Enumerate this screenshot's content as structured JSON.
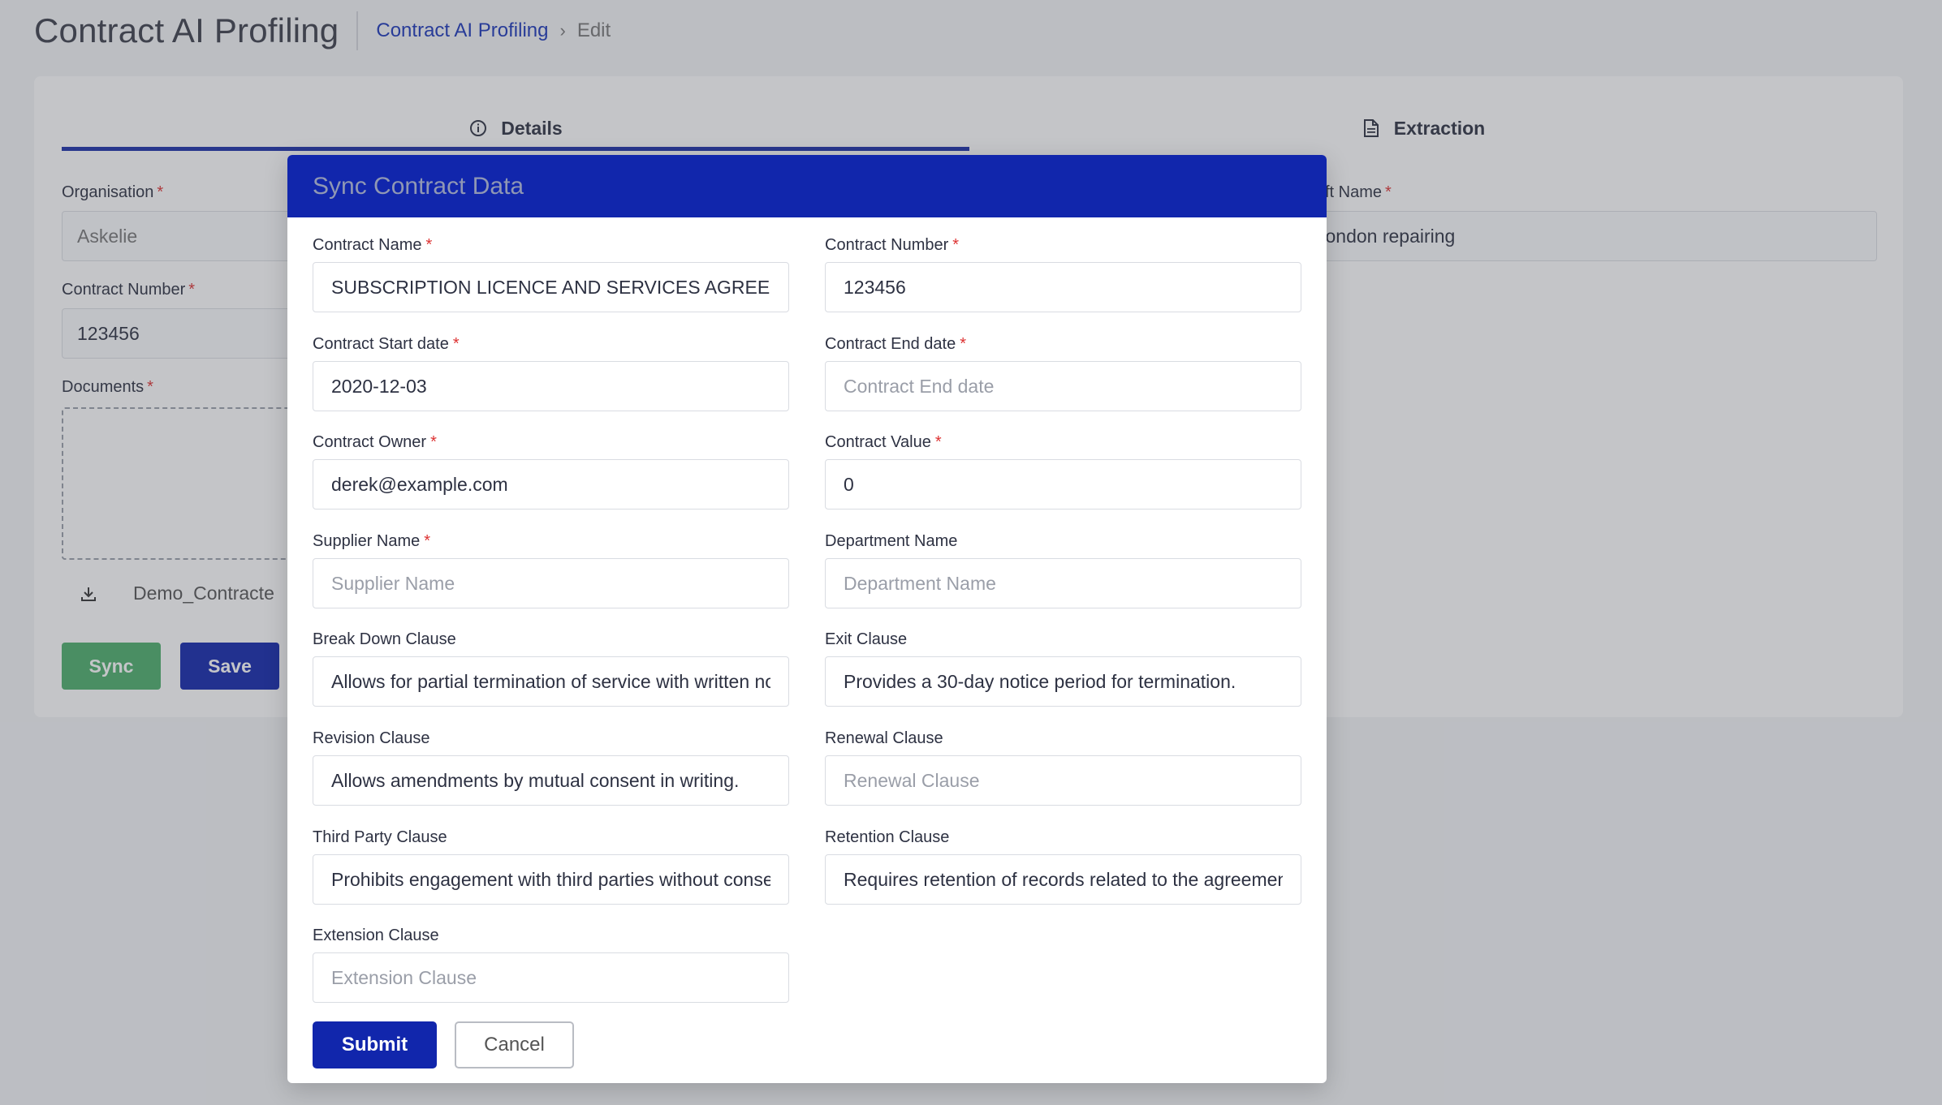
{
  "page": {
    "title": "Contract AI Profiling",
    "breadcrumb": {
      "link": "Contract AI Profiling",
      "separator": "›",
      "current": "Edit"
    }
  },
  "tabs": [
    {
      "label": "Details",
      "icon": "info-icon",
      "active": true
    },
    {
      "label": "Extraction",
      "icon": "document-icon",
      "active": false
    }
  ],
  "background_form": {
    "organisation_label": "Organisation",
    "organisation_value": "Askelie",
    "contract_number_label": "Contract Number",
    "contract_number_value": "123456",
    "documents_label": "Documents",
    "file_name": "Demo_Contracte",
    "right_label_partial": "ft Name",
    "right_value_partial": "vondon repairing",
    "sync_label": "Sync",
    "save_label": "Save"
  },
  "colors": {
    "primary": "#1126ac",
    "sync_green": "#4caf6a",
    "required": "#dd3333",
    "link": "#1a35b8"
  },
  "modal": {
    "title": "Sync Contract Data",
    "fields": {
      "contract_name": {
        "label": "Contract Name",
        "required": true,
        "value": "SUBSCRIPTION LICENCE AND SERVICES AGREEMENT",
        "placeholder": "Contract Name"
      },
      "contract_number": {
        "label": "Contract Number",
        "required": true,
        "value": "123456",
        "placeholder": "Contract Number"
      },
      "contract_start_date": {
        "label": "Contract Start date",
        "required": true,
        "value": "2020-12-03",
        "placeholder": "Contract Start date"
      },
      "contract_end_date": {
        "label": "Contract End date",
        "required": true,
        "value": "",
        "placeholder": "Contract End date"
      },
      "contract_owner": {
        "label": "Contract Owner",
        "required": true,
        "value": "derek@example.com",
        "placeholder": "Contract Owner"
      },
      "contract_value": {
        "label": "Contract Value",
        "required": true,
        "value": "0",
        "placeholder": "Contract Value"
      },
      "supplier_name": {
        "label": "Supplier Name",
        "required": true,
        "value": "",
        "placeholder": "Supplier Name"
      },
      "department_name": {
        "label": "Department Name",
        "required": false,
        "value": "",
        "placeholder": "Department Name"
      },
      "break_down_clause": {
        "label": "Break Down Clause",
        "required": false,
        "value": "Allows for partial termination of service with written notice.",
        "placeholder": "Break Down Clause"
      },
      "exit_clause": {
        "label": "Exit Clause",
        "required": false,
        "value": "Provides a 30-day notice period for termination.",
        "placeholder": "Exit Clause"
      },
      "revision_clause": {
        "label": "Revision Clause",
        "required": false,
        "value": "Allows amendments by mutual consent in writing.",
        "placeholder": "Revision Clause"
      },
      "renewal_clause": {
        "label": "Renewal Clause",
        "required": false,
        "value": "",
        "placeholder": "Renewal Clause"
      },
      "third_party_clause": {
        "label": "Third Party Clause",
        "required": false,
        "value": "Prohibits engagement with third parties without consent.",
        "placeholder": "Third Party Clause"
      },
      "retention_clause": {
        "label": "Retention Clause",
        "required": false,
        "value": "Requires retention of records related to the agreement.",
        "placeholder": "Retention Clause"
      },
      "extension_clause": {
        "label": "Extension Clause",
        "required": false,
        "value": "",
        "placeholder": "Extension Clause"
      }
    },
    "submit_label": "Submit",
    "cancel_label": "Cancel"
  }
}
